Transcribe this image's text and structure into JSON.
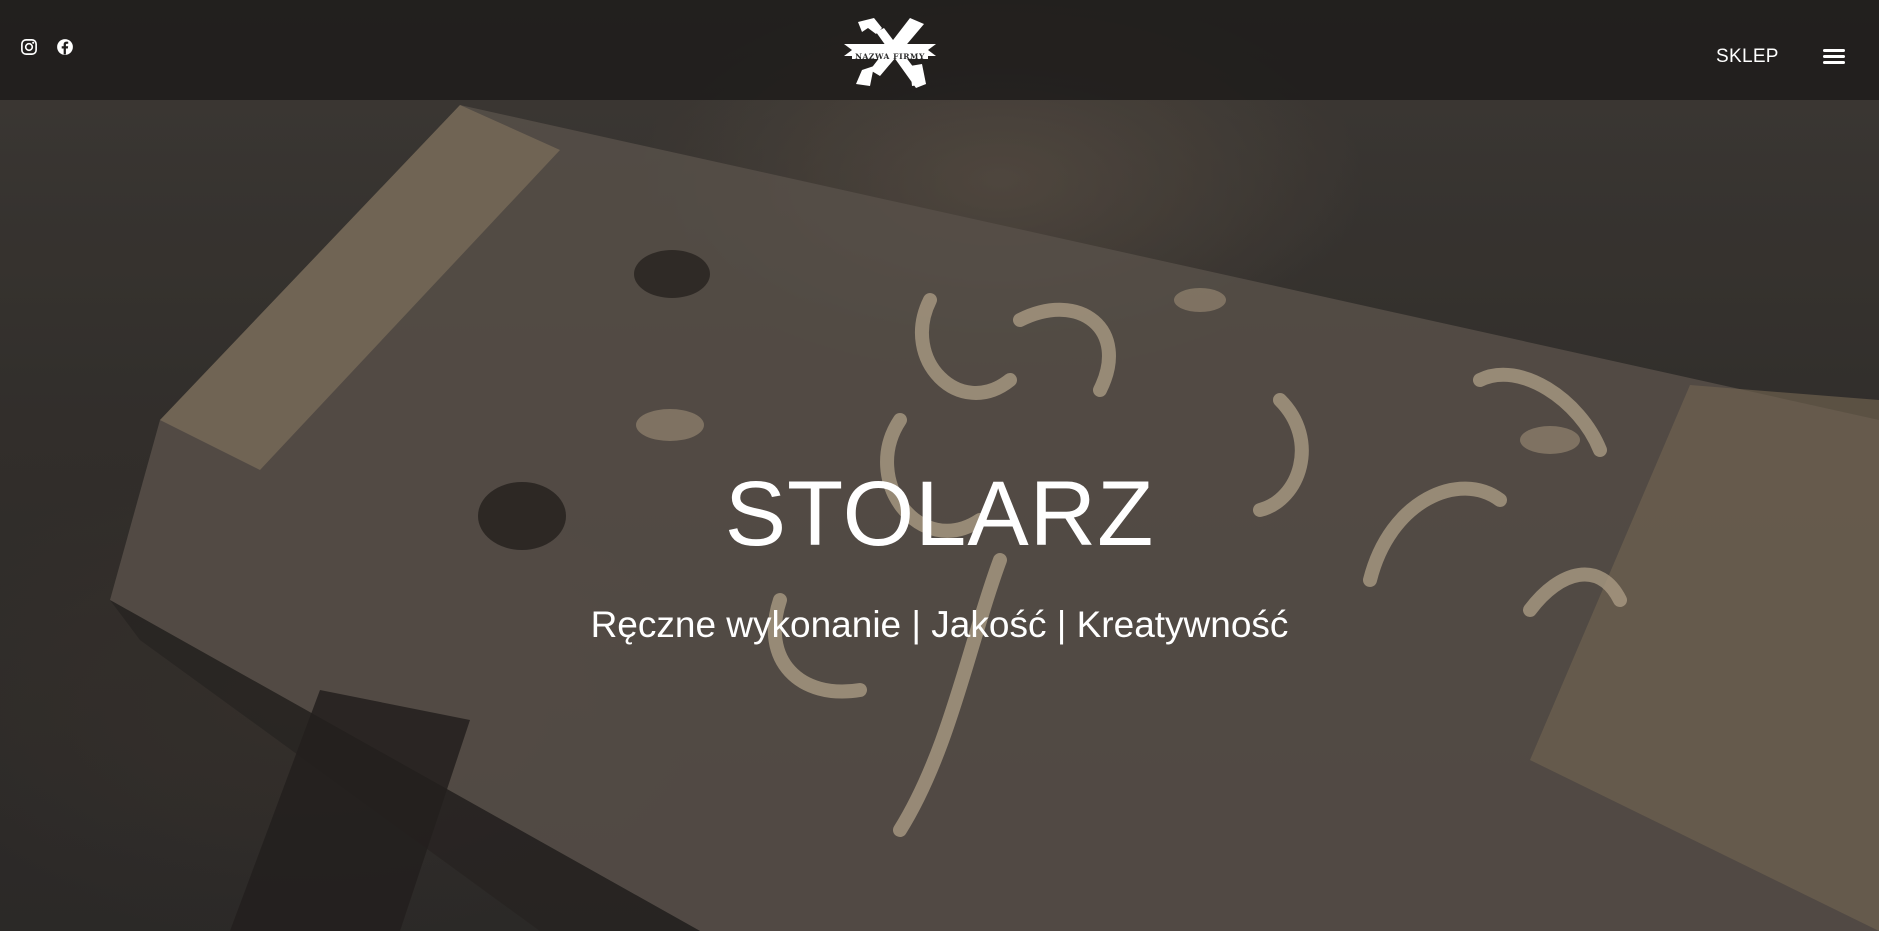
{
  "header": {
    "social": [
      {
        "icon": "instagram-icon"
      },
      {
        "icon": "facebook-icon"
      }
    ],
    "logo": {
      "text": "NAZWA FIRMY",
      "icon": "hammer-saw-logo-icon"
    },
    "nav": {
      "shop_label": "SKLEP",
      "menu_icon": "hamburger-menu-icon"
    }
  },
  "hero": {
    "title": "STOLARZ",
    "subtitle": "Ręczne wykonanie | Jakość | Kreatywność",
    "background": "wood-shavings-photo"
  },
  "colors": {
    "header_bg": "#1e1c1b",
    "text": "#ffffff",
    "wood_light": "#d8c7ad",
    "wood_dark": "#5a524a"
  }
}
